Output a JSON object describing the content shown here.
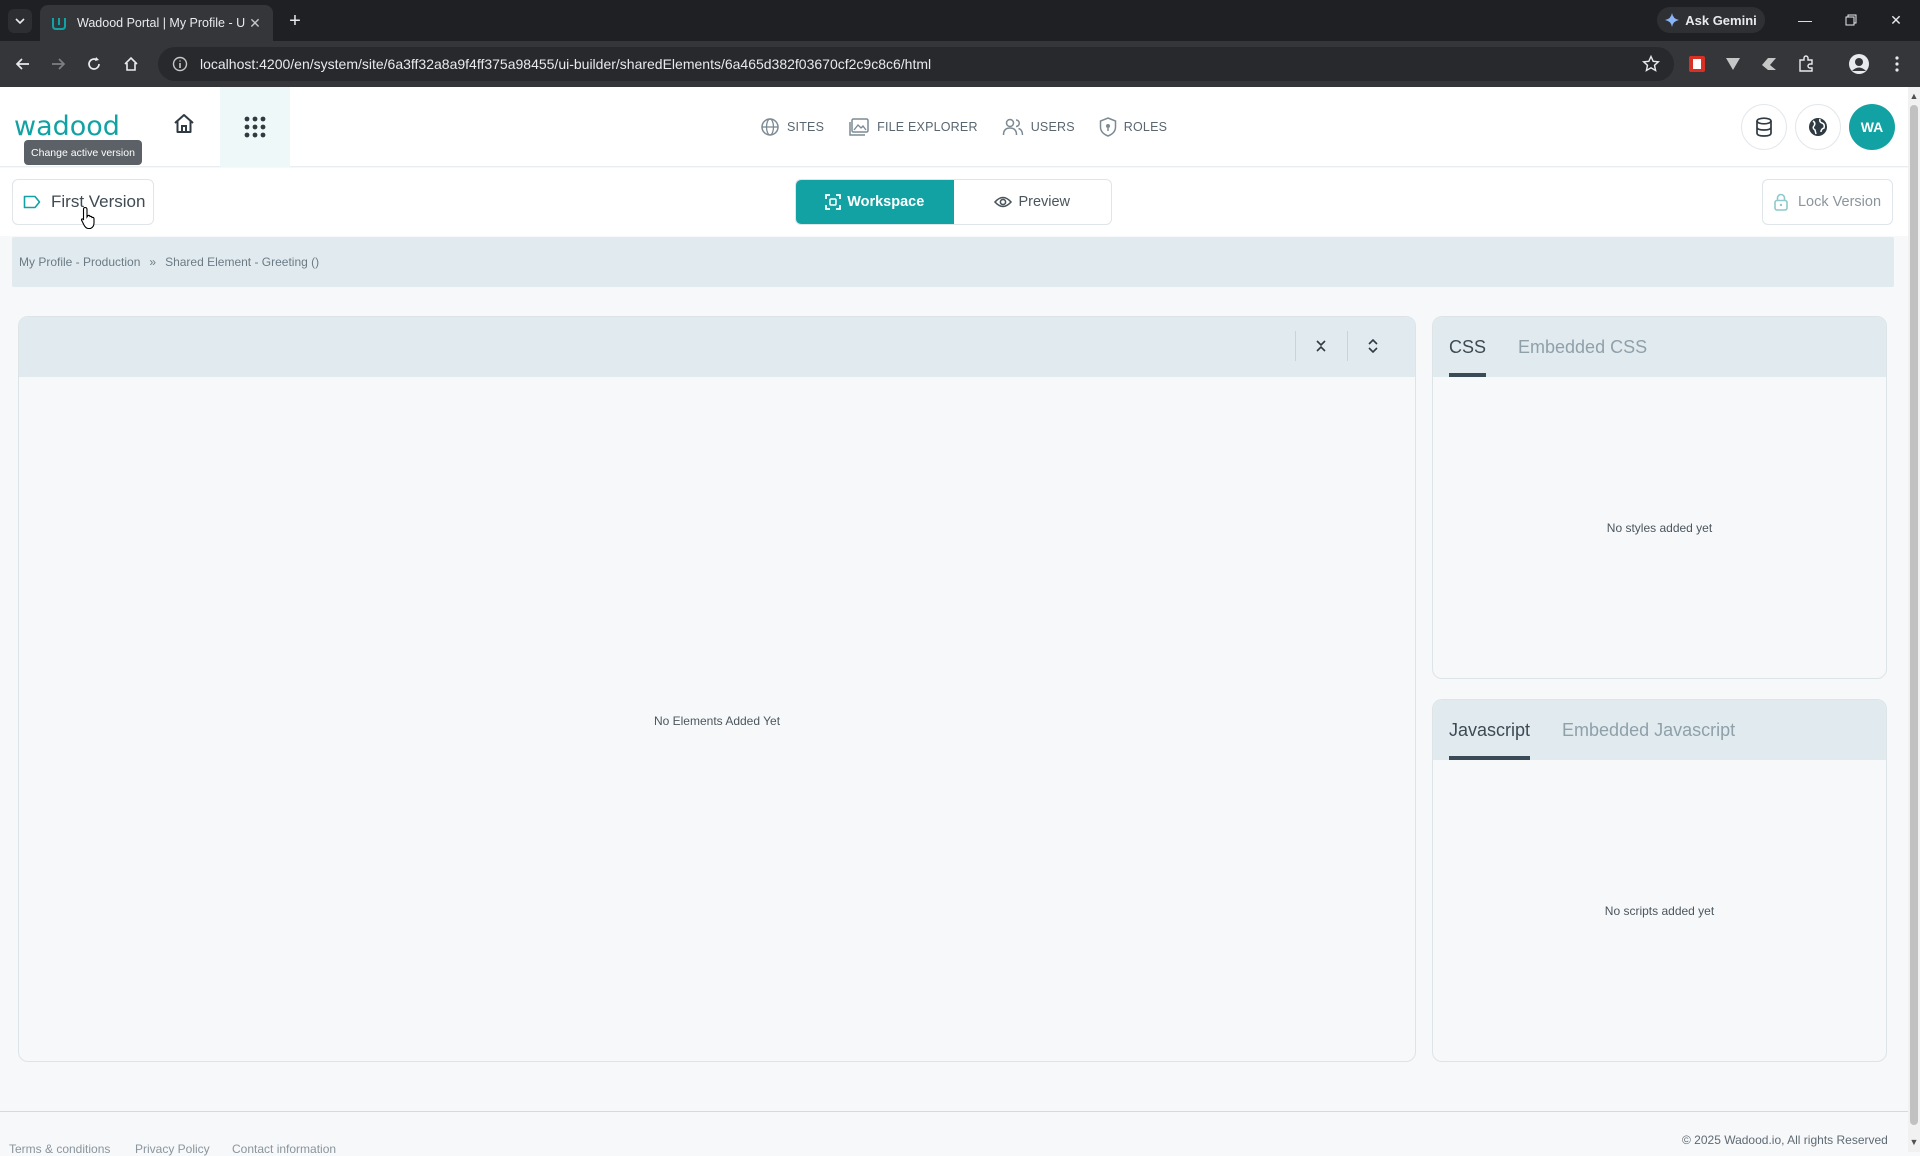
{
  "browser": {
    "tab_title": "Wadood Portal | My Profile - Ui",
    "url": "localhost:4200/en/system/site/6a3ff32a8a9f4ff375a98455/ui-builder/sharedElements/6a465d382f03670cf2c9c8c6/html",
    "gemini_label": "Ask Gemini"
  },
  "header": {
    "logo_text": "wadood",
    "nav": [
      {
        "label": "SITES",
        "icon": "globe-icon"
      },
      {
        "label": "FILE EXPLORER",
        "icon": "images-icon"
      },
      {
        "label": "USERS",
        "icon": "users-icon"
      },
      {
        "label": "ROLES",
        "icon": "shield-icon"
      }
    ],
    "avatar_initials": "WA",
    "tooltip": "Change active version"
  },
  "versionbar": {
    "version_label": "First Version",
    "workspace_label": "Workspace",
    "preview_label": "Preview",
    "lock_label": "Lock Version"
  },
  "breadcrumb": {
    "items": [
      "My Profile - Production",
      "Shared Element - Greeting ()"
    ],
    "separator": "»"
  },
  "workspace": {
    "empty_text": "No Elements Added Yet"
  },
  "css_panel": {
    "tabs": [
      "CSS",
      "Embedded CSS"
    ],
    "empty_text": "No styles added yet"
  },
  "js_panel": {
    "tabs": [
      "Javascript",
      "Embedded Javascript"
    ],
    "empty_text": "No scripts added yet"
  },
  "footer": {
    "links": [
      "Terms & conditions",
      "Privacy Policy",
      "Contact information"
    ],
    "copyright": "© 2025 Wadood.io, All rights Reserved"
  },
  "colors": {
    "accent": "#13a2a3",
    "header_band": "#e1ebef"
  }
}
